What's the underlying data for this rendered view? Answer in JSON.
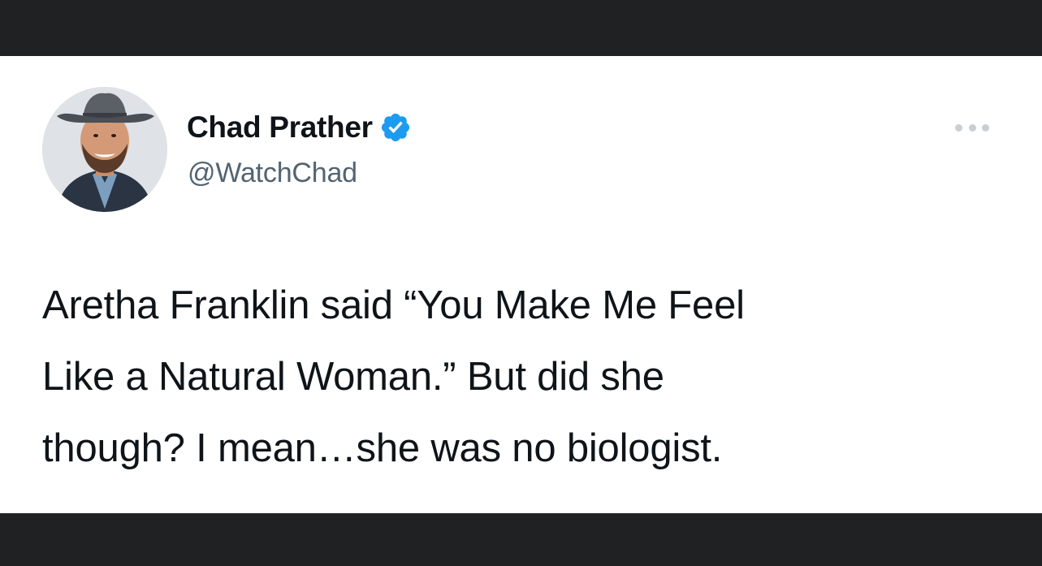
{
  "tweet": {
    "author": {
      "display_name": "Chad Prather",
      "handle": "@WatchChad",
      "verified": true
    },
    "text": "Aretha Franklin said “You Make Me Feel\nLike a Natural Woman.” But did she\nthough? I mean…she was no biologist."
  },
  "icons": {
    "verified": "verified-badge-icon",
    "more": "more-options-icon"
  },
  "colors": {
    "frame": "#202123",
    "card": "#ffffff",
    "name": "#0f1419",
    "handle": "#536471",
    "verified": "#1d9bf0",
    "more_dots": "#c9ced3"
  }
}
